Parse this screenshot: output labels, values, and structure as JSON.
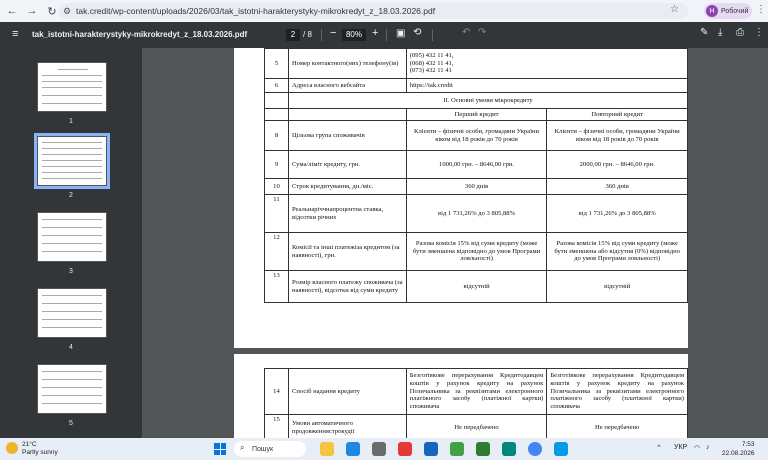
{
  "browser": {
    "url": "tak.credit/wp-content/uploads/2026/03/tak_istotni-harakterystyky-mikrokredyt_z_18.03.2026.pdf",
    "profile_label": "Робочий",
    "profile_initial": "Н"
  },
  "pdf": {
    "filename": "tak_istotni-harakterystyky-mikrokredyt_z_18.03.2026.pdf",
    "current_page": "2",
    "total_pages": "/ 8",
    "zoom": "80%"
  },
  "thumbnails": [
    "1",
    "2",
    "3",
    "4",
    "5"
  ],
  "page1_rows": {
    "r5_num": "5",
    "r5_label": "Номер контактного(них) телефону(ів)",
    "r5_value": "(095) 432 11 41,\n(068) 432 11 41,\n(073) 432 11 41",
    "r6_num": "6",
    "r6_label": "Адреса власного вебсайта",
    "r6_value": "https://tak.credit",
    "section_title": "ІІ. Основні умови мікрокредиту",
    "col_first": "Перший кредит",
    "col_repeat": "Повторний кредит",
    "r8_num": "8",
    "r8_label": "Цільова група споживачів",
    "r8_first": "Клієнти – фізичні особи, громадяни України віком від 18 років до 70 років",
    "r8_repeat": "Клієнти – фізичні особи, громадяни України віком від 18 років до 70 років",
    "r9_num": "9",
    "r9_label": "Сума/ліміт кредиту, грн.",
    "r9_first": "1000,00 грн. – 8646,00 грн.",
    "r9_repeat": "2000,00 грн. – 8646,00 грн.",
    "r10_num": "10",
    "r10_label": "Строк кредитування, дн./міс.",
    "r10_first": "360 днів",
    "r10_repeat": "360 днів",
    "r11_num": "11",
    "r11_label": "Реальнаріччнапроцентна ставка, відсотки річних",
    "r11_first": "від 1 731,26% до 3 805,88%",
    "r11_repeat": "від 1 731,26% до 3 805,88%",
    "r12_num": "12",
    "r12_label": "Комісії та інші платежіза кредитом (за наявності), грн.",
    "r12_first": "Разова комісія 15% від суми кредиту (може бути зменшена відповідно до умов Програми лояльності)",
    "r12_repeat": "Разова комісія 15% від суми кредиту (може бути зменшена або відсутня (0%) відповідно до умов Програми лояльності)",
    "r13_num": "13",
    "r13_label": "Розмір власного платежу споживача (за наявності), відсотки від суми кредиту",
    "r13_first": "відсутній",
    "r13_repeat": "відсутній"
  },
  "page2_rows": {
    "r14_num": "14",
    "r14_label": "Спосіб надання кредиту",
    "r14_first": "Безготівкове перерахування Кредитодавцем коштів у рахунок кредиту на рахунок Позичальника за реквізитами електронного платіжного засобу (платіжної картки) споживача",
    "r14_repeat": "Безготівкове перерахування Кредитодавцем коштів у рахунок кредиту на рахунок Позичальника за реквізитами електронного платіжного засобу (платіжної картки) споживача",
    "r15_num": "15",
    "r15_label": "Умови автоматичного продовженнястрокудії",
    "r15_first": "Не передбачено",
    "r15_repeat": "Не передбачено"
  },
  "taskbar": {
    "temp": "21°C",
    "weather": "Partly sunny",
    "search": "Пошук",
    "lang": "УКР",
    "time": "7:53",
    "date": "22.08.2026"
  }
}
